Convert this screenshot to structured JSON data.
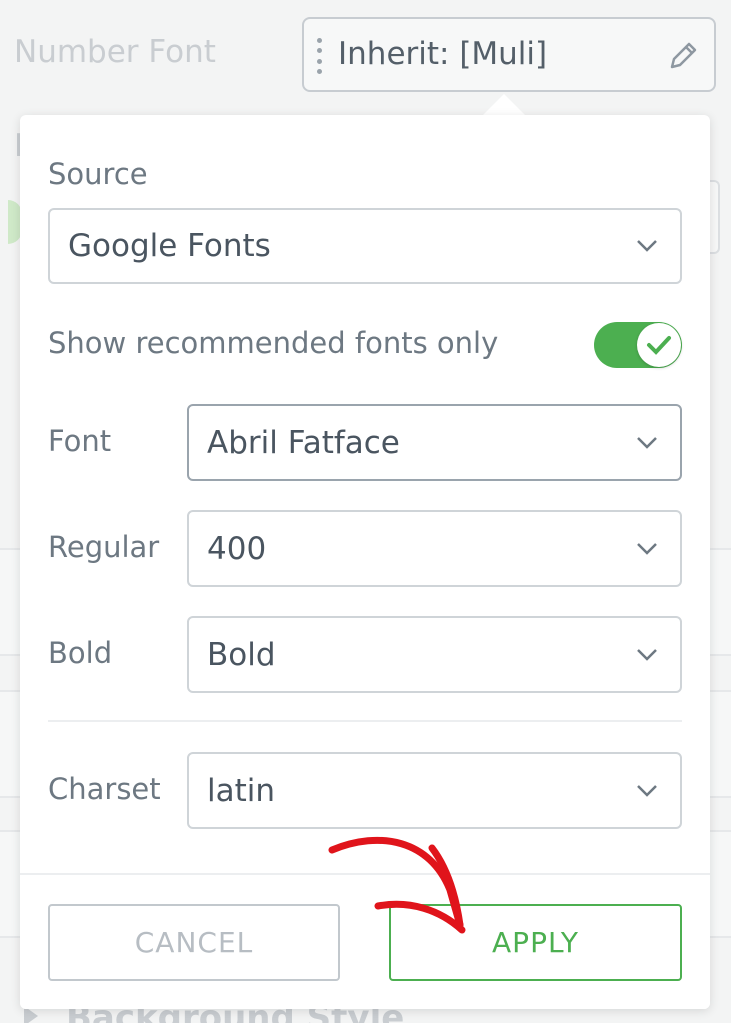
{
  "background": {
    "number_font_label": "Number Font",
    "cut_label_stub": "I",
    "bottom_section_label": "Background Style",
    "number_font_value": "Inherit: [Muli]"
  },
  "popover": {
    "source_label": "Source",
    "source_value": "Google Fonts",
    "recommended_label": "Show recommended fonts only",
    "recommended_on": true,
    "font_label": "Font",
    "font_value": "Abril Fatface",
    "regular_label": "Regular",
    "regular_value": "400",
    "bold_label": "Bold",
    "bold_value": "Bold",
    "charset_label": "Charset",
    "charset_value": "latin",
    "cancel_label": "CANCEL",
    "apply_label": "APPLY"
  },
  "colors": {
    "accent_green": "#4caf50",
    "annotation_red": "#e0141b"
  },
  "icons": [
    "drag-handle-icon",
    "pencil-icon",
    "chevron-down-icon",
    "checkmark-icon",
    "annotation-arrow"
  ]
}
